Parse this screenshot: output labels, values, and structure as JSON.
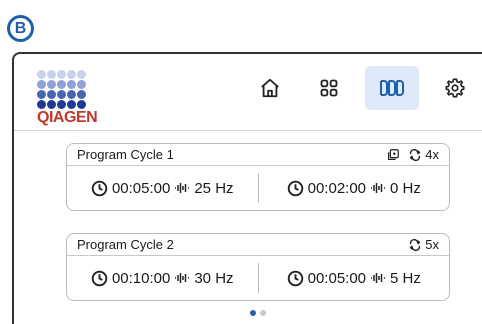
{
  "panel_label": "B",
  "brand": {
    "name": "QIAGEN"
  },
  "colors": {
    "accent": "#1f5fa8",
    "nav_active_bg": "#dde9f8",
    "logo_red": "#c0392b",
    "dot_active": "#2f5fb3",
    "dot_inactive": "#c9c9c9"
  },
  "nav": {
    "items": [
      {
        "name": "home",
        "icon": "home-icon",
        "active": false
      },
      {
        "name": "grid",
        "icon": "grid-icon",
        "active": false
      },
      {
        "name": "program",
        "icon": "program-icon",
        "active": true
      },
      {
        "name": "settings",
        "icon": "gear-icon",
        "active": false
      }
    ]
  },
  "cycles": [
    {
      "title": "Program Cycle 1",
      "queue_icon": "queue-icon",
      "repeat": "4x",
      "steps": [
        {
          "time": "00:05:00",
          "freq": "25 Hz"
        },
        {
          "time": "00:02:00",
          "freq": "0 Hz"
        }
      ]
    },
    {
      "title": "Program Cycle 2",
      "repeat": "5x",
      "steps": [
        {
          "time": "00:10:00",
          "freq": "30 Hz"
        },
        {
          "time": "00:05:00",
          "freq": "5 Hz"
        }
      ]
    }
  ],
  "pager": {
    "page": 1,
    "total": 2
  }
}
